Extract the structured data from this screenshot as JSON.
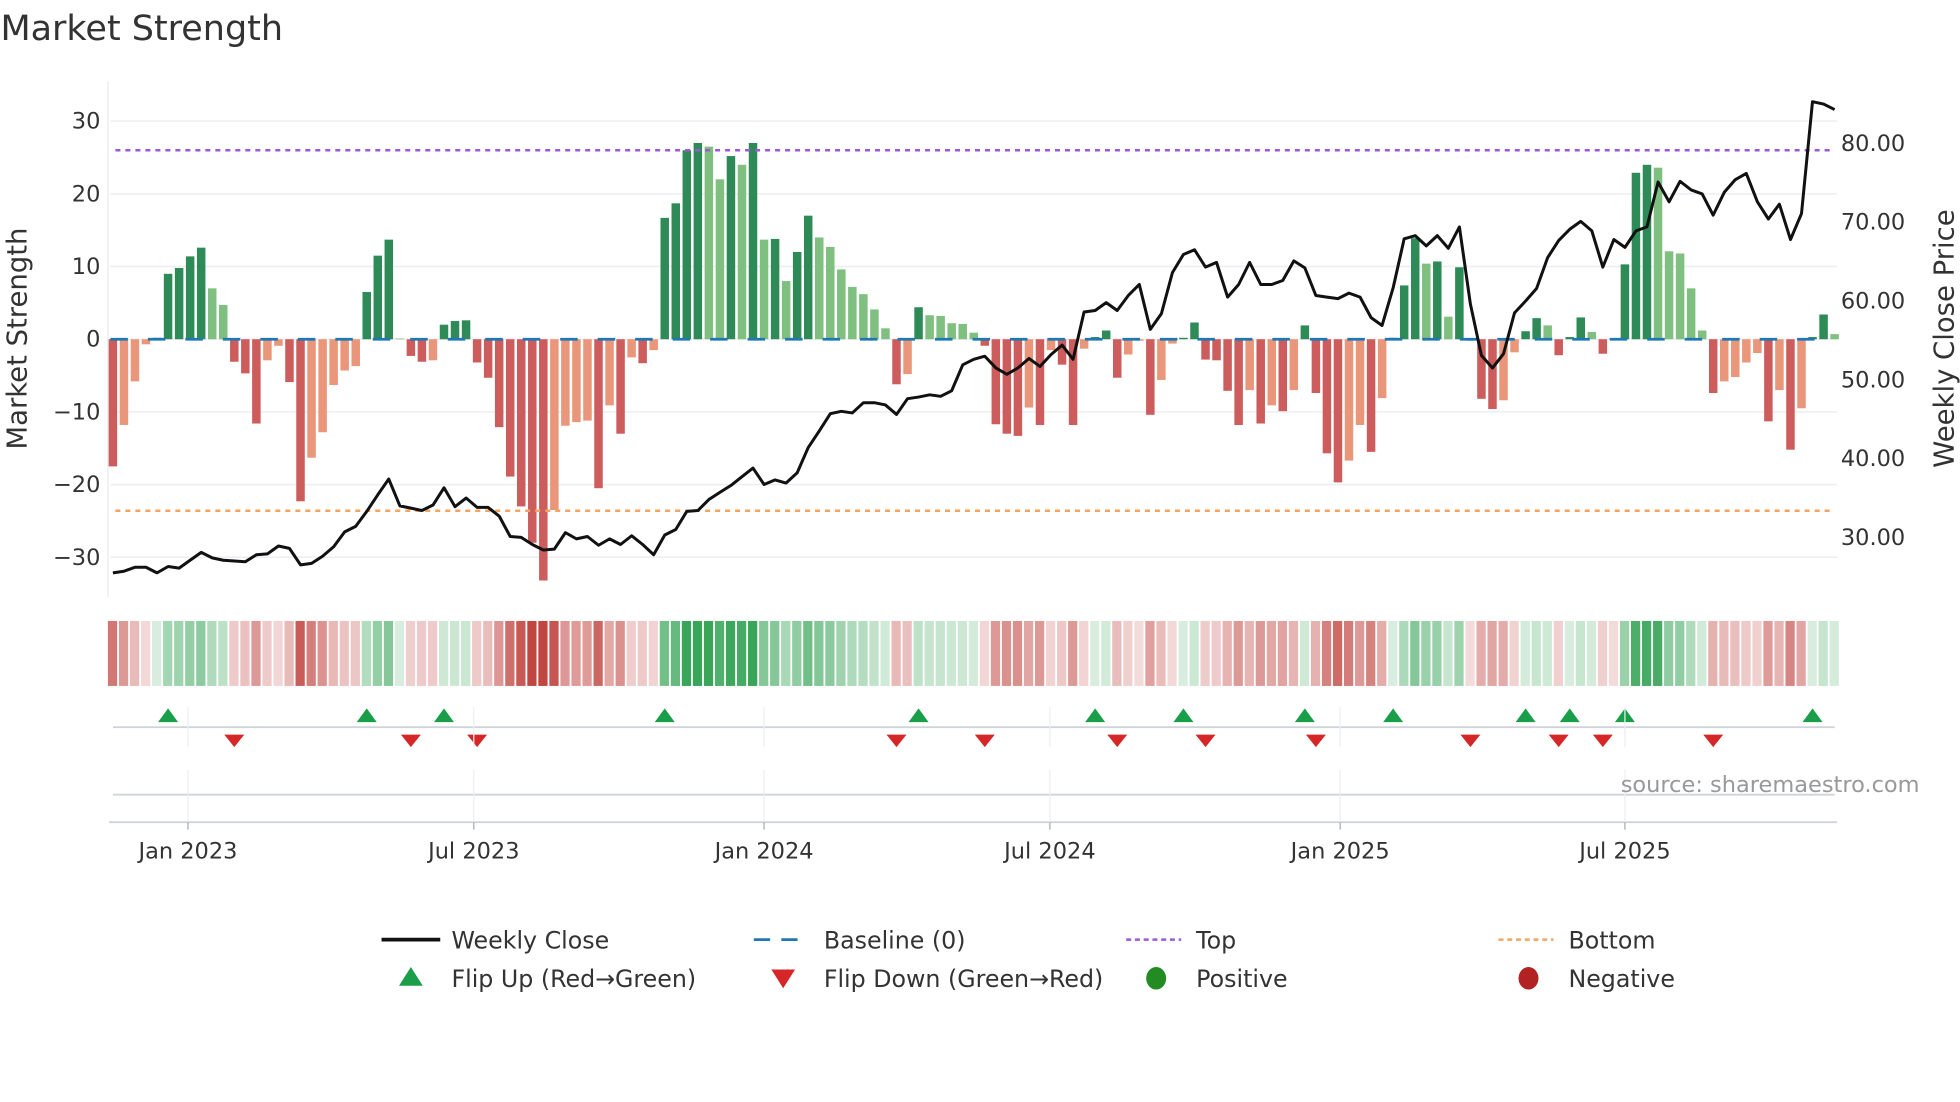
{
  "chart_data": {
    "type": "bar",
    "title": "Market Strength",
    "ylabel": "Market Strength",
    "y2label": "Weekly Close Price",
    "ylim": [
      -35.5,
      35.5
    ],
    "y2lim": [
      22.4,
      87.9
    ],
    "top_level": 26,
    "bottom_level": -23.6,
    "yticks": [
      30,
      20,
      10,
      0,
      -10,
      -20,
      -30
    ],
    "ytick_labels": [
      "30",
      "20",
      "10",
      "0",
      "−10",
      "−20",
      "−30"
    ],
    "y2ticks": [
      80,
      70,
      60,
      50,
      40,
      30
    ],
    "y2tick_labels": [
      "80.00",
      "70.00",
      "60.00",
      "50.00",
      "40.00",
      "30.00"
    ],
    "xticks": [
      {
        "week_index": 6.8,
        "label": "Jan 2023"
      },
      {
        "week_index": 32.7,
        "label": "Jul 2023"
      },
      {
        "week_index": 59.0,
        "label": "Jan 2024"
      },
      {
        "week_index": 84.9,
        "label": "Jul 2024"
      },
      {
        "week_index": 111.2,
        "label": "Jan 2025"
      },
      {
        "week_index": 137.0,
        "label": "Jul 2025"
      }
    ],
    "strength": [
      -17.5,
      -11.8,
      -5.8,
      -0.7,
      0.2,
      9.0,
      9.8,
      11.4,
      12.6,
      7.0,
      4.7,
      -3.1,
      -4.7,
      -11.6,
      -2.9,
      -0.9,
      -5.9,
      -22.3,
      -16.3,
      -12.8,
      -6.3,
      -4.3,
      -3.7,
      6.5,
      11.5,
      13.7,
      0.1,
      -2.3,
      -3.1,
      -2.9,
      2.0,
      2.5,
      2.6,
      -3.2,
      -5.3,
      -12.1,
      -18.9,
      -23,
      -28,
      -33.2,
      -23.5,
      -11.9,
      -11.4,
      -11.2,
      -20.5,
      -9.1,
      -13,
      -2.5,
      -3.3,
      -1.5,
      16.7,
      18.7,
      26,
      27,
      26.5,
      22,
      25.2,
      24,
      27,
      13.7,
      13.8,
      8,
      12,
      17,
      14,
      12.7,
      9.6,
      7.2,
      6.2,
      4.1,
      1.5,
      -6.2,
      -4.8,
      4.4,
      3.3,
      3.2,
      2.2,
      2.1,
      0.9,
      -0.9,
      -11.7,
      -13,
      -13.3,
      -9.4,
      -11.8,
      -1.5,
      -3.5,
      -11.8,
      -1.3,
      0.3,
      1.2,
      -5.3,
      -2.1,
      -0.2,
      -10.4,
      -5.6,
      -0.6,
      0.2,
      2.3,
      -2.8,
      -2.9,
      -7.1,
      -11.8,
      -7.0,
      -11.6,
      -9.1,
      -9.9,
      -7.0,
      1.9,
      -7.4,
      -15.7,
      -19.7,
      -16.7,
      -11.8,
      -15.5,
      -8.1,
      0.2,
      7.4,
      13.9,
      10.4,
      10.7,
      3.1,
      9.9,
      -0.2,
      -8.2,
      -9.6,
      -8.4,
      -1.8,
      1.1,
      2.9,
      1.9,
      -2.2,
      0.3,
      3.0,
      1.0,
      -2,
      -0.1,
      10.3,
      22.9,
      24,
      23.6,
      12.1,
      11.8,
      7,
      1.2,
      -7.4,
      -5.8,
      -5.2,
      -3.2,
      -1.9,
      -11.3,
      -7,
      -15.2,
      -9.5,
      0.3,
      3.4,
      0.7
    ],
    "weekly_close": [
      25.5,
      25.7,
      26.2,
      26.2,
      25.5,
      26.3,
      26.1,
      27.1,
      28.1,
      27.4,
      27.1,
      27.0,
      26.9,
      27.8,
      27.9,
      28.9,
      28.6,
      26.5,
      26.7,
      27.6,
      28.8,
      30.7,
      31.4,
      33.3,
      35.4,
      37.4,
      34.0,
      33.7,
      33.4,
      34.1,
      36.3,
      33.9,
      35.0,
      33.8,
      33.8,
      32.7,
      30.1,
      30.0,
      29.1,
      28.4,
      28.5,
      30.6,
      29.8,
      30.1,
      29.0,
      29.8,
      29.1,
      30.2,
      29.1,
      27.8,
      30.3,
      31.0,
      33.3,
      33.4,
      34.8,
      35.7,
      36.6,
      37.7,
      38.8,
      36.7,
      37.3,
      36.9,
      38.2,
      41.4,
      43.5,
      45.7,
      46.0,
      45.8,
      47.1,
      47.1,
      46.8,
      45.6,
      47.6,
      47.8,
      48.1,
      47.9,
      48.6,
      51.9,
      52.6,
      53.0,
      51.5,
      50.7,
      51.5,
      52.7,
      51.7,
      53.2,
      54.4,
      52.6,
      58.6,
      58.8,
      59.8,
      58.8,
      60.7,
      62.1,
      56.4,
      58.4,
      63.6,
      65.9,
      66.5,
      64.3,
      64.9,
      60.5,
      62.1,
      64.9,
      62.1,
      62.1,
      62.6,
      65.1,
      64.2,
      60.7,
      60.5,
      60.3,
      61.0,
      60.5,
      57.9,
      56.9,
      61.7,
      67.9,
      68.3,
      67.0,
      68.3,
      66.7,
      69.4,
      59.6,
      53.1,
      51.5,
      53.3,
      58.5,
      60.0,
      61.6,
      65.5,
      67.7,
      69.1,
      70.1,
      68.9,
      64.3,
      67.8,
      66.8,
      68.9,
      69.4,
      75.1,
      72.6,
      75.2,
      74.1,
      73.6,
      70.9,
      73.8,
      75.4,
      76.2,
      72.6,
      70.4,
      72.3,
      67.8,
      71.1,
      85.3,
      85.0,
      84.3
    ],
    "flip_up_weeks": [
      5,
      23,
      30,
      50,
      73,
      89,
      97,
      108,
      116,
      128,
      132,
      137,
      154
    ],
    "flip_down_weeks": [
      11,
      27,
      33,
      71,
      79,
      91,
      99,
      109,
      123,
      131,
      135,
      145
    ],
    "legend": {
      "placement": "bottom",
      "items": [
        {
          "label": "Weekly Close"
        },
        {
          "label": "Baseline (0)"
        },
        {
          "label": "Top"
        },
        {
          "label": "Bottom"
        },
        {
          "label": "Flip Up (Red→Green)"
        },
        {
          "label": "Flip Down (Green→Red)"
        },
        {
          "label": "Positive"
        },
        {
          "label": "Negative"
        }
      ]
    },
    "source": "source: sharemaestro.com",
    "colors": {
      "green_strong": "#2e8b57",
      "green_weak": "#7fbf7f",
      "red_strong": "#cd5c5c",
      "red_weak": "#e9967a",
      "baseline": "#1f77b4",
      "top": "#9b59d6",
      "bottom": "#f4a460",
      "line": "#111111",
      "flip_up": "#1a9e4a",
      "flip_down": "#d62728",
      "positive": "#228b22",
      "negative": "#b22222"
    }
  }
}
